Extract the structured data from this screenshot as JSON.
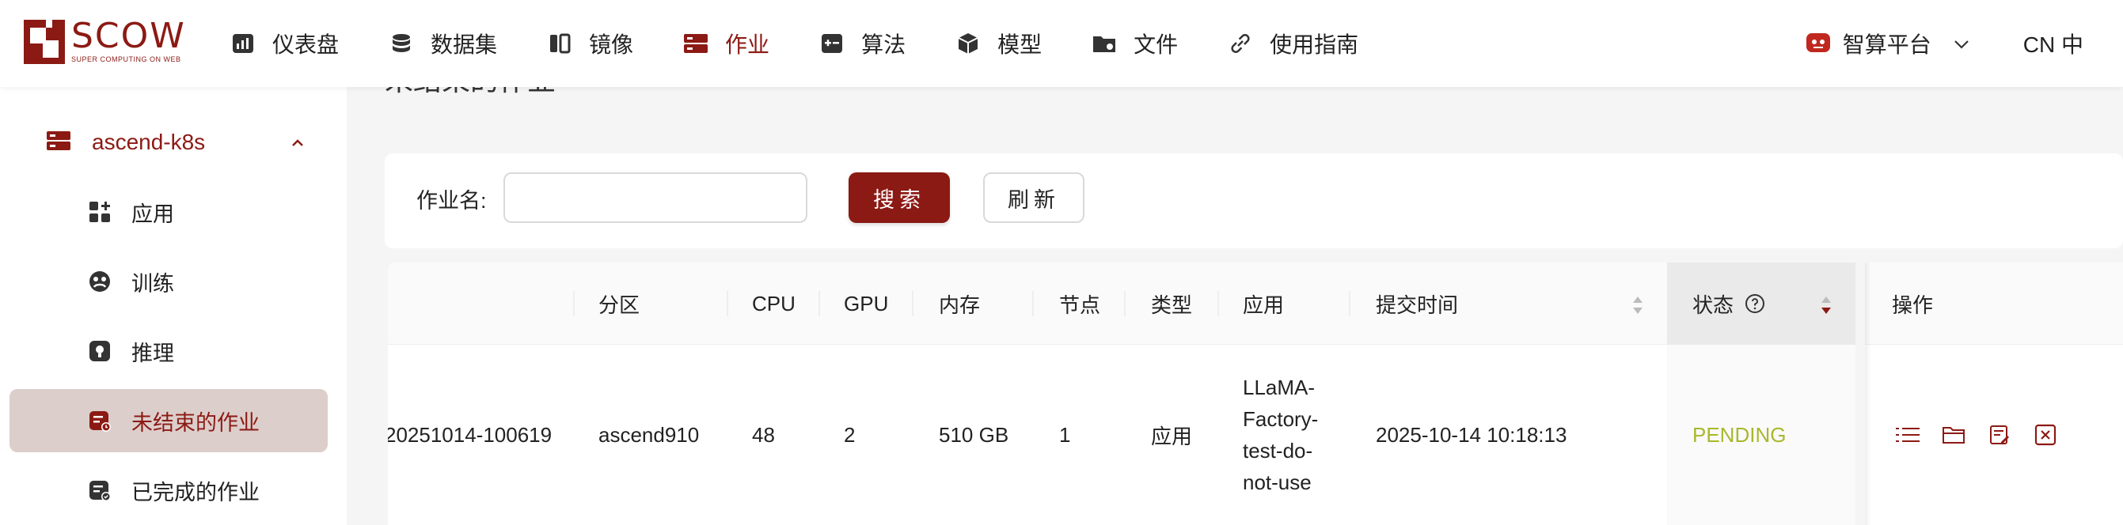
{
  "brand": {
    "name": "SCOW",
    "tagline": "SUPER COMPUTING ON WEB",
    "color": "#8c1a14"
  },
  "nav": [
    {
      "label": "仪表盘",
      "icon": "dashboard-icon"
    },
    {
      "label": "数据集",
      "icon": "database-icon"
    },
    {
      "label": "镜像",
      "icon": "image-icon"
    },
    {
      "label": "作业",
      "icon": "jobs-icon",
      "active": true
    },
    {
      "label": "算法",
      "icon": "algorithm-icon"
    },
    {
      "label": "模型",
      "icon": "cube-icon"
    },
    {
      "label": "文件",
      "icon": "folder-icon"
    },
    {
      "label": "使用指南",
      "icon": "link-icon"
    }
  ],
  "header_right": {
    "platform": "智算平台",
    "language": "CN 中"
  },
  "sidebar": {
    "cluster": "ascend-k8s",
    "items": [
      {
        "label": "应用",
        "icon": "apps-icon"
      },
      {
        "label": "训练",
        "icon": "training-icon"
      },
      {
        "label": "推理",
        "icon": "inference-icon"
      },
      {
        "label": "未结束的作业",
        "icon": "running-jobs-icon",
        "active": true
      },
      {
        "label": "已完成的作业",
        "icon": "finished-jobs-icon"
      }
    ]
  },
  "page": {
    "title": "未结束的作业"
  },
  "search": {
    "label": "作业名:",
    "value": "",
    "search_button": "搜索",
    "refresh_button": "刷新"
  },
  "table": {
    "columns": {
      "partition": "分区",
      "cpu": "CPU",
      "gpu": "GPU",
      "memory": "内存",
      "nodes": "节点",
      "type": "类型",
      "app": "应用",
      "submit_time": "提交时间",
      "status": "状态",
      "actions": "操作"
    },
    "rows": [
      {
        "name": "20251014-100619",
        "partition": "ascend910",
        "cpu": "48",
        "gpu": "2",
        "memory": "510 GB",
        "nodes": "1",
        "type": "应用",
        "app_lines": [
          "LLaMA-",
          "Factory-",
          "test-do-",
          "not-use"
        ],
        "submit_time": "2025-10-14 10:18:13",
        "status": "PENDING",
        "status_color": "#a9b82c"
      }
    ]
  }
}
